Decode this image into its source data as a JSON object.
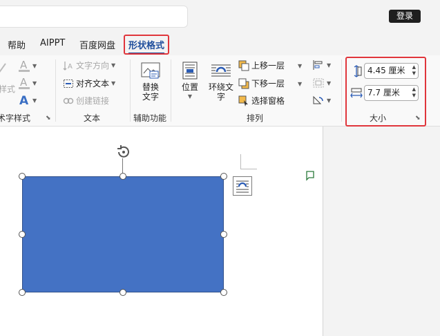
{
  "titlebar": {
    "login_label": "登录"
  },
  "tabs": [
    {
      "label": "帮助"
    },
    {
      "label": "AIPPT"
    },
    {
      "label": "百度网盘"
    },
    {
      "label": "形状格式",
      "active": true
    }
  ],
  "ribbon": {
    "wordart": {
      "text_effect_label": "样式",
      "group_label": "艺术字样式"
    },
    "text": {
      "direction_label": "文字方向",
      "align_label": "对齐文本",
      "link_label": "创建链接",
      "group_label": "文本"
    },
    "accessibility": {
      "alt_text_label": "替换\n文字",
      "group_label": "辅助功能"
    },
    "arrange": {
      "position_label": "位置",
      "wrap_label": "环绕文\n字",
      "bring_forward_label": "上移一层",
      "send_backward_label": "下移一层",
      "selection_pane_label": "选择窗格",
      "group_label": "排列"
    },
    "size": {
      "height_value": "4.45 厘米",
      "width_value": "7.7 厘米",
      "group_label": "大小"
    }
  },
  "colors": {
    "accent": "#1f4e9c",
    "highlight_border": "#e0353b",
    "shape_fill": "#4472c4"
  }
}
